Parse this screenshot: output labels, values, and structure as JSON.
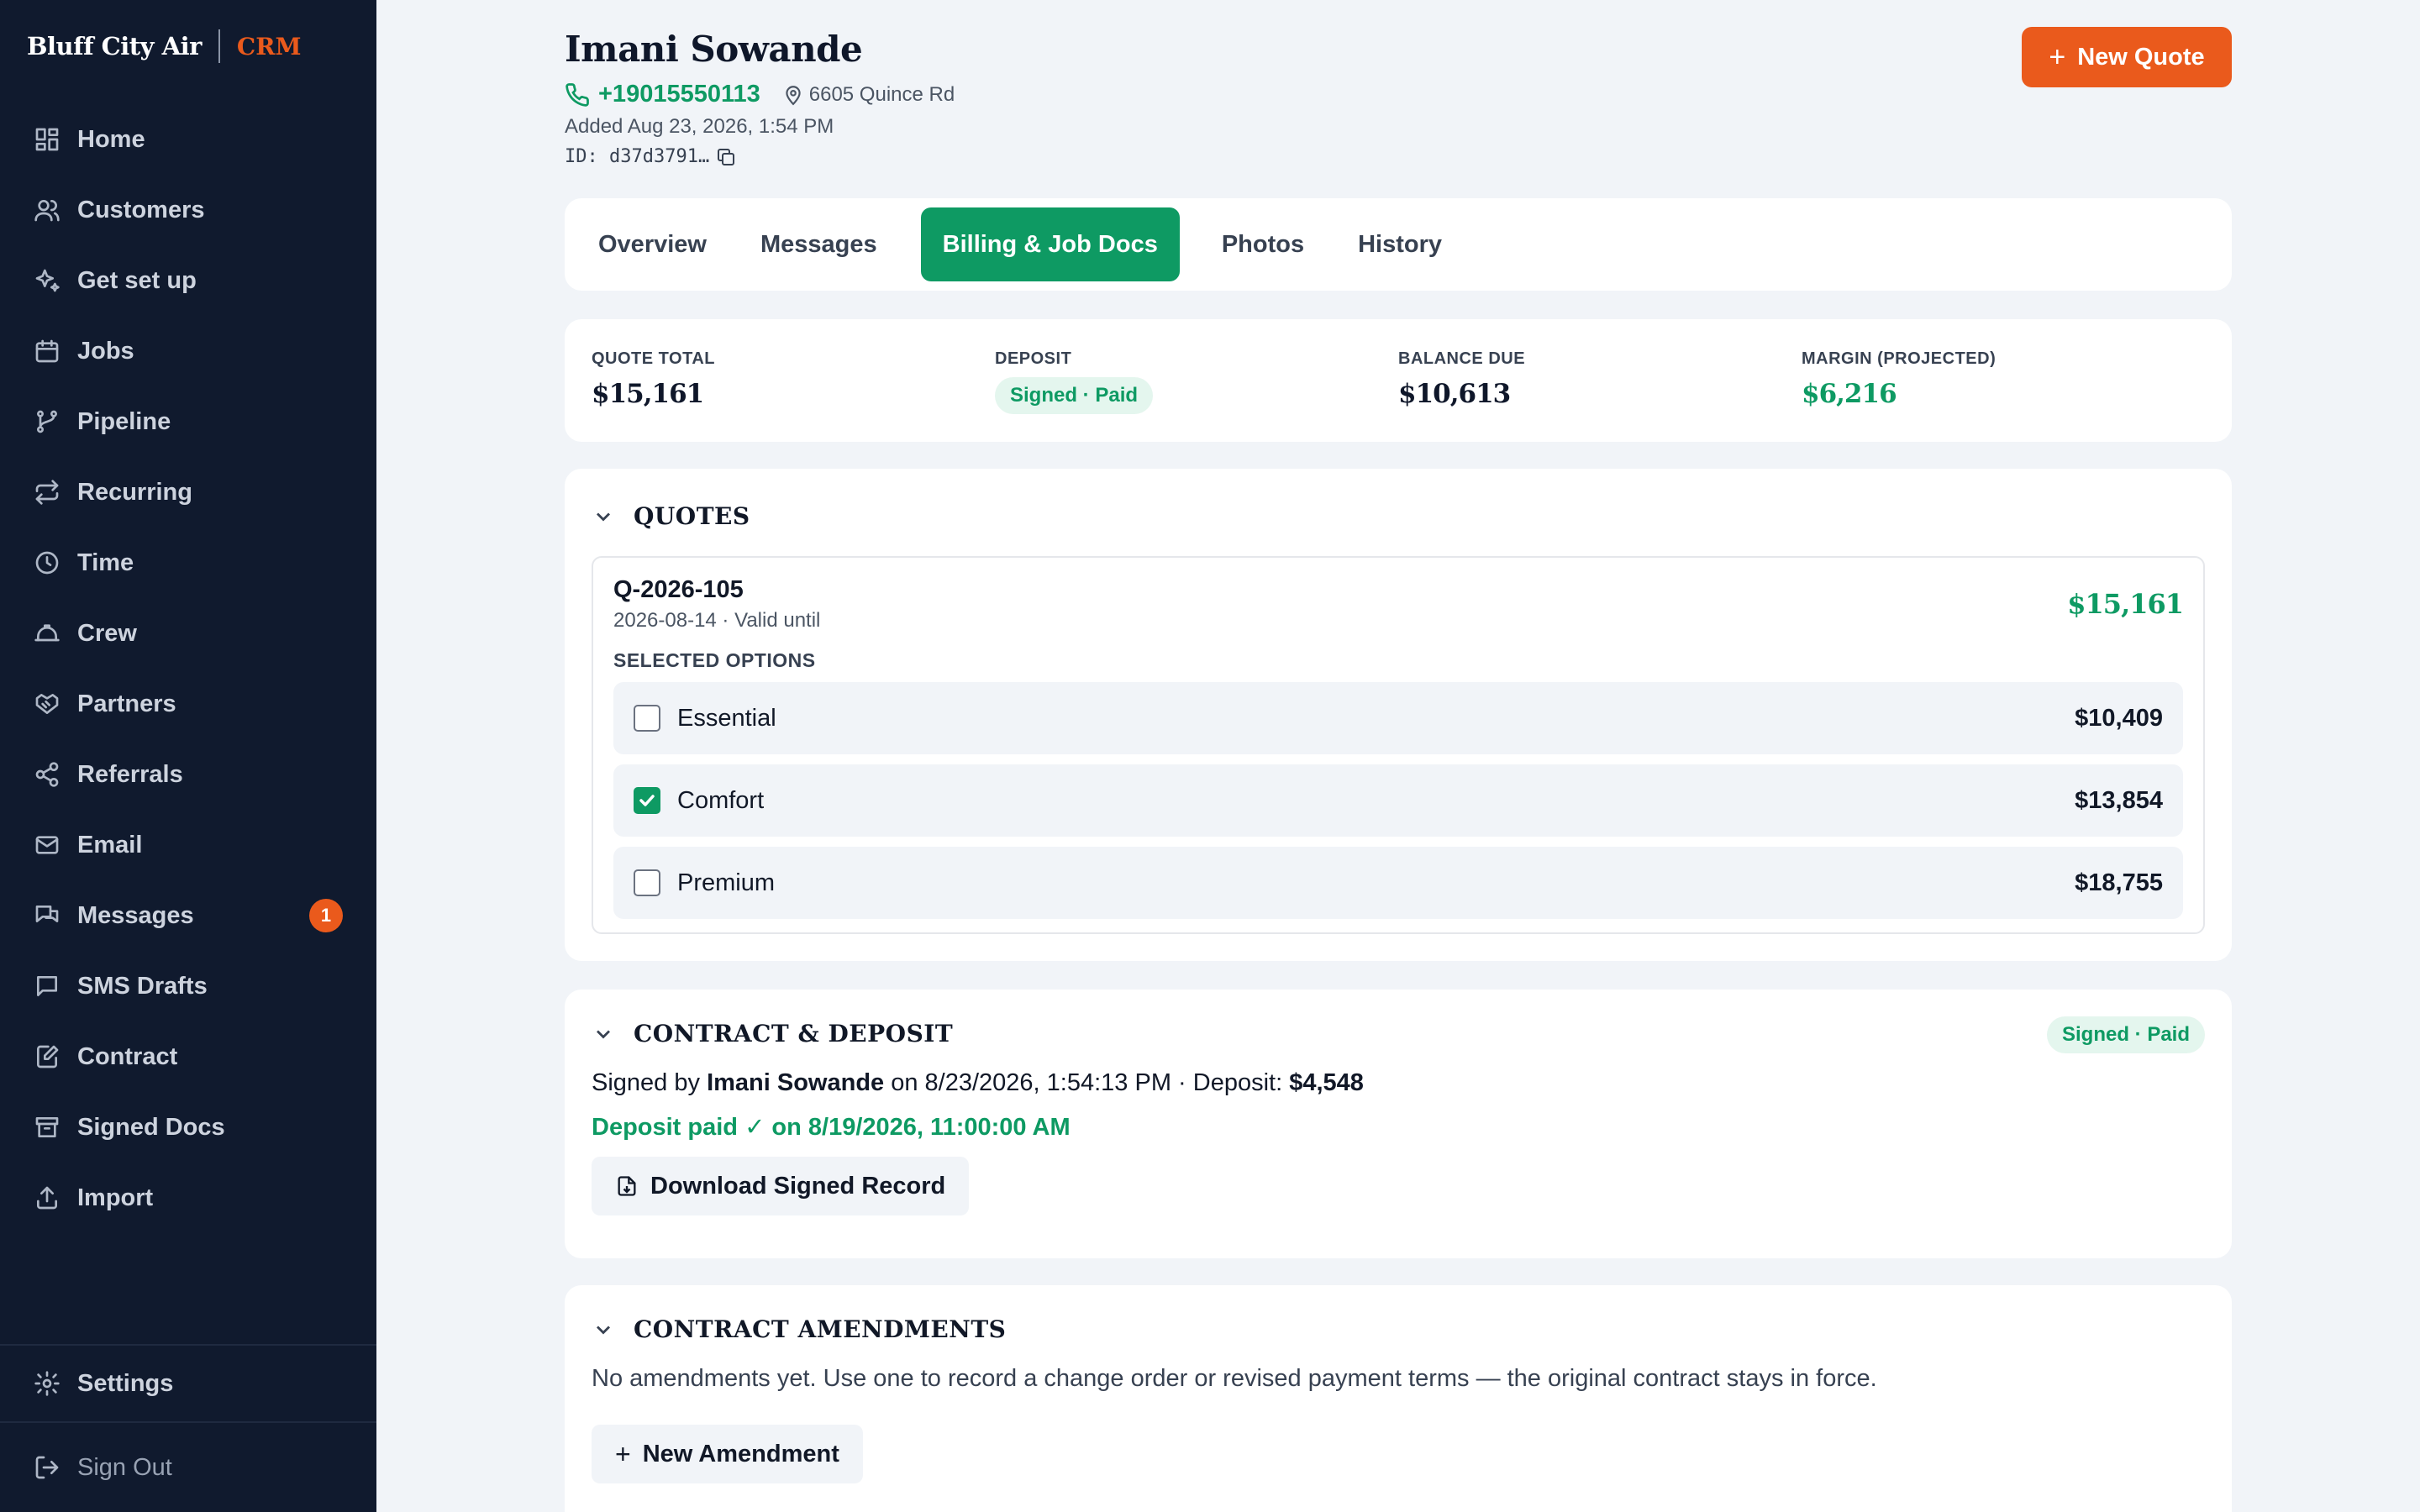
{
  "brand": {
    "name": "Bluff City Air",
    "product": "CRM"
  },
  "sidebar": {
    "items": [
      {
        "label": "Home",
        "icon": "grid-icon"
      },
      {
        "label": "Customers",
        "icon": "users-icon"
      },
      {
        "label": "Get set up",
        "icon": "sparkle-icon"
      },
      {
        "label": "Jobs",
        "icon": "calendar-icon"
      },
      {
        "label": "Pipeline",
        "icon": "branch-icon"
      },
      {
        "label": "Recurring",
        "icon": "repeat-icon"
      },
      {
        "label": "Time",
        "icon": "clock-icon"
      },
      {
        "label": "Crew",
        "icon": "hardhat-icon"
      },
      {
        "label": "Partners",
        "icon": "handshake-icon"
      },
      {
        "label": "Referrals",
        "icon": "share-icon"
      },
      {
        "label": "Email",
        "icon": "mail-icon"
      },
      {
        "label": "Messages",
        "icon": "chat-icon",
        "badge": "1"
      },
      {
        "label": "SMS Drafts",
        "icon": "message-square-icon"
      },
      {
        "label": "Contract",
        "icon": "file-edit-icon"
      },
      {
        "label": "Signed Docs",
        "icon": "archive-icon"
      },
      {
        "label": "Import",
        "icon": "upload-icon"
      }
    ],
    "settings": "Settings",
    "signout": "Sign Out"
  },
  "customer": {
    "name": "Imani Sowande",
    "phone": "+19015550113",
    "address": "6605 Quince Rd",
    "added": "Added Aug 23, 2026, 1:54 PM",
    "id": "ID: d37d3791…"
  },
  "header": {
    "new_quote": "New Quote"
  },
  "tabs": [
    {
      "label": "Overview",
      "active": false
    },
    {
      "label": "Messages",
      "active": false
    },
    {
      "label": "Billing & Job Docs",
      "active": true
    },
    {
      "label": "Photos",
      "active": false
    },
    {
      "label": "History",
      "active": false
    }
  ],
  "summary": {
    "quote_total_label": "QUOTE TOTAL",
    "quote_total": "$15,161",
    "deposit_label": "DEPOSIT",
    "deposit_status": "Signed · Paid",
    "balance_label": "BALANCE DUE",
    "balance": "$10,613",
    "margin_label": "MARGIN (PROJECTED)",
    "margin": "$6,216"
  },
  "quotes": {
    "title": "QUOTES",
    "quote": {
      "id": "Q-2026-105",
      "subtitle": "2026-08-14 · Valid until",
      "total": "$15,161",
      "options_label": "SELECTED OPTIONS",
      "options": [
        {
          "name": "Essential",
          "price": "$10,409",
          "checked": false
        },
        {
          "name": "Comfort",
          "price": "$13,854",
          "checked": true
        },
        {
          "name": "Premium",
          "price": "$18,755",
          "checked": false
        }
      ]
    }
  },
  "contract": {
    "title": "CONTRACT & DEPOSIT",
    "status": "Signed · Paid",
    "signed_prefix": "Signed by",
    "signer": "Imani Sowande",
    "signed_mid": "on 8/23/2026, 1:54:13 PM · Deposit:",
    "deposit": "$4,548",
    "paid_line": "Deposit paid ✓ on 8/19/2026, 11:00:00 AM",
    "download": "Download Signed Record"
  },
  "amendments": {
    "title": "CONTRACT AMENDMENTS",
    "text": "No amendments yet. Use one to record a change order or revised payment terms — the original contract stays in force.",
    "button": "New Amendment"
  },
  "colors": {
    "accent": "#ea5a1c",
    "green": "#0e9a63",
    "sidebar": "#101a2e"
  }
}
